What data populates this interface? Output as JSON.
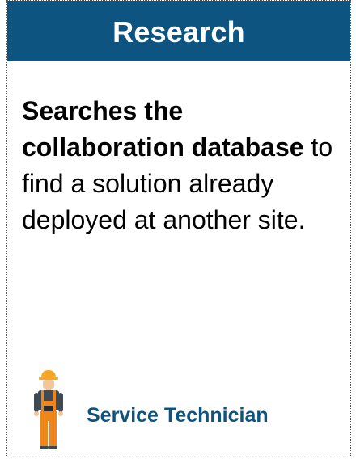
{
  "card": {
    "title": "Research",
    "description": {
      "bold": "Searches the collaboration database",
      "rest": " to find a solution already deployed at another site."
    },
    "role": {
      "label": "Service Technician",
      "icon": "service-technician-icon"
    }
  },
  "colors": {
    "header_background": "#0d5580",
    "header_text": "#ffffff",
    "role_text": "#0d5580",
    "hard_hat": "#f5a623",
    "overalls": "#f08519",
    "shirt": "#3f4a52",
    "skin": "#f2c59a"
  }
}
